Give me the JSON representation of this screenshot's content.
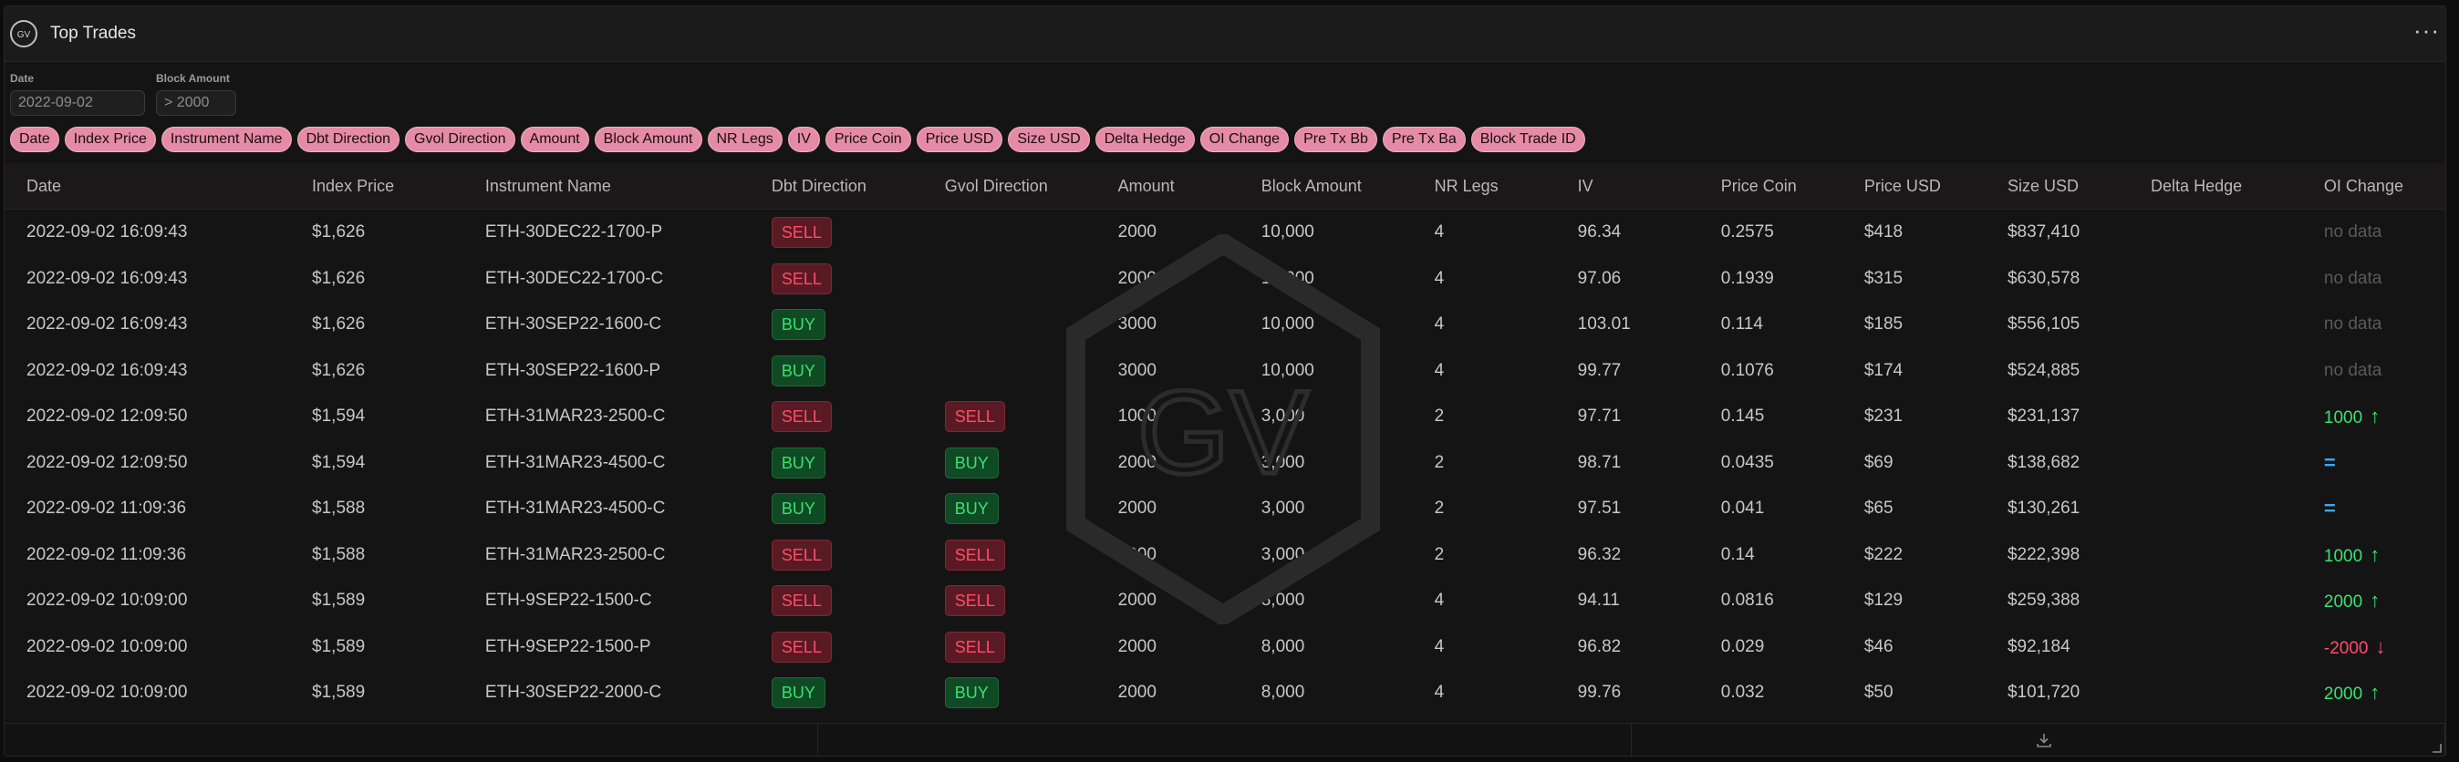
{
  "header": {
    "title": "Top Trades",
    "menu": "···"
  },
  "filters": {
    "date_label": "Date",
    "date_value": "2022-09-02",
    "block_label": "Block Amount",
    "block_value": "> 2000"
  },
  "chips": [
    "Date",
    "Index Price",
    "Instrument Name",
    "Dbt Direction",
    "Gvol Direction",
    "Amount",
    "Block Amount",
    "NR Legs",
    "IV",
    "Price Coin",
    "Price USD",
    "Size USD",
    "Delta Hedge",
    "OI Change",
    "Pre Tx Bb",
    "Pre Tx Ba",
    "Block Trade ID"
  ],
  "columns": [
    "Date",
    "Index Price",
    "Instrument Name",
    "Dbt Direction",
    "Gvol Direction",
    "Amount",
    "Block Amount",
    "NR Legs",
    "IV",
    "Price Coin",
    "Price USD",
    "Size USD",
    "Delta Hedge",
    "OI Change"
  ],
  "rows": [
    {
      "date": "2022-09-02 16:09:43",
      "index": "$1,626",
      "instrument": "ETH-30DEC22-1700-P",
      "dbt": "SELL",
      "gvol": "",
      "amount": "2000",
      "block": "10,000",
      "legs": "4",
      "iv": "96.34",
      "coin": "0.2575",
      "usd": "$418",
      "size": "$837,410",
      "delta": "",
      "oi": "no data",
      "oi_type": "nodata"
    },
    {
      "date": "2022-09-02 16:09:43",
      "index": "$1,626",
      "instrument": "ETH-30DEC22-1700-C",
      "dbt": "SELL",
      "gvol": "",
      "amount": "2000",
      "block": "10,000",
      "legs": "4",
      "iv": "97.06",
      "coin": "0.1939",
      "usd": "$315",
      "size": "$630,578",
      "delta": "",
      "oi": "no data",
      "oi_type": "nodata"
    },
    {
      "date": "2022-09-02 16:09:43",
      "index": "$1,626",
      "instrument": "ETH-30SEP22-1600-C",
      "dbt": "BUY",
      "gvol": "",
      "amount": "3000",
      "block": "10,000",
      "legs": "4",
      "iv": "103.01",
      "coin": "0.114",
      "usd": "$185",
      "size": "$556,105",
      "delta": "",
      "oi": "no data",
      "oi_type": "nodata"
    },
    {
      "date": "2022-09-02 16:09:43",
      "index": "$1,626",
      "instrument": "ETH-30SEP22-1600-P",
      "dbt": "BUY",
      "gvol": "",
      "amount": "3000",
      "block": "10,000",
      "legs": "4",
      "iv": "99.77",
      "coin": "0.1076",
      "usd": "$174",
      "size": "$524,885",
      "delta": "",
      "oi": "no data",
      "oi_type": "nodata"
    },
    {
      "date": "2022-09-02 12:09:50",
      "index": "$1,594",
      "instrument": "ETH-31MAR23-2500-C",
      "dbt": "SELL",
      "gvol": "SELL",
      "amount": "1000",
      "block": "3,000",
      "legs": "2",
      "iv": "97.71",
      "coin": "0.145",
      "usd": "$231",
      "size": "$231,137",
      "delta": "",
      "oi": "1000",
      "oi_type": "up"
    },
    {
      "date": "2022-09-02 12:09:50",
      "index": "$1,594",
      "instrument": "ETH-31MAR23-4500-C",
      "dbt": "BUY",
      "gvol": "BUY",
      "amount": "2000",
      "block": "3,000",
      "legs": "2",
      "iv": "98.71",
      "coin": "0.0435",
      "usd": "$69",
      "size": "$138,682",
      "delta": "",
      "oi": "=",
      "oi_type": "eq"
    },
    {
      "date": "2022-09-02 11:09:36",
      "index": "$1,588",
      "instrument": "ETH-31MAR23-4500-C",
      "dbt": "BUY",
      "gvol": "BUY",
      "amount": "2000",
      "block": "3,000",
      "legs": "2",
      "iv": "97.51",
      "coin": "0.041",
      "usd": "$65",
      "size": "$130,261",
      "delta": "",
      "oi": "=",
      "oi_type": "eq"
    },
    {
      "date": "2022-09-02 11:09:36",
      "index": "$1,588",
      "instrument": "ETH-31MAR23-2500-C",
      "dbt": "SELL",
      "gvol": "SELL",
      "amount": "1000",
      "block": "3,000",
      "legs": "2",
      "iv": "96.32",
      "coin": "0.14",
      "usd": "$222",
      "size": "$222,398",
      "delta": "",
      "oi": "1000",
      "oi_type": "up"
    },
    {
      "date": "2022-09-02 10:09:00",
      "index": "$1,589",
      "instrument": "ETH-9SEP22-1500-C",
      "dbt": "SELL",
      "gvol": "SELL",
      "amount": "2000",
      "block": "8,000",
      "legs": "4",
      "iv": "94.11",
      "coin": "0.0816",
      "usd": "$129",
      "size": "$259,388",
      "delta": "",
      "oi": "2000",
      "oi_type": "up"
    },
    {
      "date": "2022-09-02 10:09:00",
      "index": "$1,589",
      "instrument": "ETH-9SEP22-1500-P",
      "dbt": "SELL",
      "gvol": "SELL",
      "amount": "2000",
      "block": "8,000",
      "legs": "4",
      "iv": "96.82",
      "coin": "0.029",
      "usd": "$46",
      "size": "$92,184",
      "delta": "",
      "oi": "-2000",
      "oi_type": "down"
    },
    {
      "date": "2022-09-02 10:09:00",
      "index": "$1,589",
      "instrument": "ETH-30SEP22-2000-C",
      "dbt": "BUY",
      "gvol": "BUY",
      "amount": "2000",
      "block": "8,000",
      "legs": "4",
      "iv": "99.76",
      "coin": "0.032",
      "usd": "$50",
      "size": "$101,720",
      "delta": "",
      "oi": "2000",
      "oi_type": "up"
    }
  ],
  "icons": {
    "logo": "gv-logo-icon",
    "menu": "more-dots-icon",
    "download": "download-icon",
    "resize": "resize-handle-icon",
    "watermark": "gv-watermark-icon"
  },
  "colors": {
    "sell": "#ff4d6a",
    "buy": "#3be070",
    "chip": "#e58ba8",
    "eq": "#3aa8ff"
  }
}
